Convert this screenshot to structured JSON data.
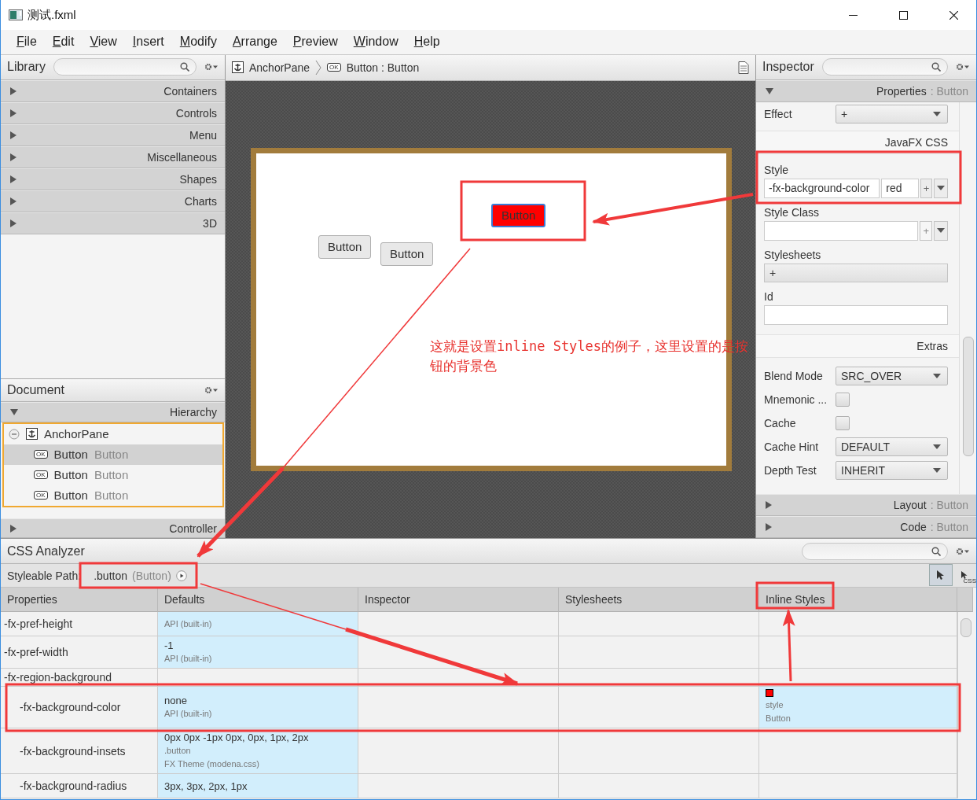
{
  "window": {
    "title": "测试.fxml"
  },
  "menu": [
    "File",
    "Edit",
    "View",
    "Insert",
    "Modify",
    "Arrange",
    "Preview",
    "Window",
    "Help"
  ],
  "library": {
    "title": "Library",
    "sections": [
      {
        "label": "Containers",
        "expanded": false
      },
      {
        "label": "Controls",
        "expanded": false
      },
      {
        "label": "Menu",
        "expanded": false
      },
      {
        "label": "Miscellaneous",
        "expanded": false
      },
      {
        "label": "Shapes",
        "expanded": false
      },
      {
        "label": "Charts",
        "expanded": false
      },
      {
        "label": "3D",
        "expanded": false
      }
    ]
  },
  "document": {
    "title": "Document",
    "hierarchy": {
      "label": "Hierarchy",
      "expanded": true
    },
    "tree": {
      "label": "AnchorPane",
      "expanded": true,
      "children": [
        {
          "badge": "OK",
          "label": "Button",
          "type_label": "Button",
          "selected": true
        },
        {
          "badge": "OK",
          "label": "Button",
          "type_label": "Button",
          "selected": false
        },
        {
          "badge": "OK",
          "label": "Button",
          "type_label": "Button",
          "selected": false
        }
      ]
    },
    "controller": {
      "label": "Controller",
      "expanded": false
    }
  },
  "breadcrumb": [
    {
      "kind": "anchor",
      "label": "AnchorPane"
    },
    {
      "kind": "control",
      "badge": "OK",
      "label": "Button : Button"
    }
  ],
  "canvas": {
    "buttons": [
      {
        "label": "Button",
        "selected": true,
        "color": "#ff0000"
      },
      {
        "label": "Button",
        "selected": false,
        "color": "#e8e8e8"
      },
      {
        "label": "Button",
        "selected": false,
        "color": "#e8e8e8"
      }
    ],
    "annotation": "这就是设置inline Styles的例子，这里设置的是按钮的背景色"
  },
  "inspector": {
    "title": "Inspector",
    "properties": {
      "label": "Properties",
      "detail": ": Button",
      "expanded": true
    },
    "rows": [
      {
        "kind": "dropdown",
        "label": "Effect",
        "value": "+"
      },
      {
        "kind": "section",
        "label": "JavaFX CSS"
      },
      {
        "kind": "style",
        "label": "Style",
        "property": "-fx-background-color",
        "value": "red",
        "add": "+",
        "add_disabled": false
      },
      {
        "kind": "list",
        "label": "Style Class",
        "add": "+",
        "add_disabled": true
      },
      {
        "kind": "add",
        "label": "Stylesheets",
        "value": "+"
      },
      {
        "kind": "text",
        "label": "Id"
      },
      {
        "kind": "section",
        "label": "Extras"
      },
      {
        "kind": "dropdown",
        "label": "Blend Mode",
        "value": "SRC_OVER"
      },
      {
        "kind": "checkbox",
        "label": "Mnemonic ...",
        "checked": false
      },
      {
        "kind": "checkbox",
        "label": "Cache",
        "checked": false
      },
      {
        "kind": "dropdown",
        "label": "Cache Hint",
        "value": "DEFAULT"
      },
      {
        "kind": "dropdown",
        "label": "Depth Test",
        "value": "INHERIT"
      }
    ],
    "sections": [
      {
        "label": "Layout",
        "detail": ": Button",
        "expanded": false
      },
      {
        "label": "Code",
        "detail": ": Button",
        "expanded": false
      }
    ]
  },
  "css_analyzer": {
    "title": "CSS Analyzer",
    "path_label": "Styleable Path:",
    "path": ".button",
    "path_detail": "(Button)",
    "tools": [
      {
        "kind": "pick",
        "selected": true
      },
      {
        "kind": "pick_css",
        "badge": "CSS",
        "selected": false
      }
    ],
    "columns": [
      "Properties",
      "Defaults",
      "Inspector",
      "Stylesheets",
      "Inline Styles"
    ],
    "rows": [
      {
        "property": "-fx-pref-height",
        "defaults": {
          "source": [
            "API (built-in)"
          ]
        }
      },
      {
        "property": "-fx-pref-width",
        "defaults": {
          "value": "-1",
          "source": [
            "API (built-in)"
          ]
        }
      },
      {
        "property": "-fx-region-background",
        "children": [
          {
            "property": "-fx-background-color",
            "defaults": {
              "value": "none",
              "source": [
                "API (built-in)"
              ]
            },
            "inline": {
              "color": "#ff0000",
              "source": [
                "style",
                "Button"
              ]
            }
          },
          {
            "property": "-fx-background-insets",
            "defaults": {
              "value": "0px 0px -1px 0px, 0px, 1px, 2px",
              "source": [
                ".button",
                "FX Theme (modena.css)"
              ]
            }
          },
          {
            "property": "-fx-background-radius",
            "defaults": {
              "value": "3px, 3px, 2px, 1px"
            }
          }
        ]
      }
    ]
  }
}
